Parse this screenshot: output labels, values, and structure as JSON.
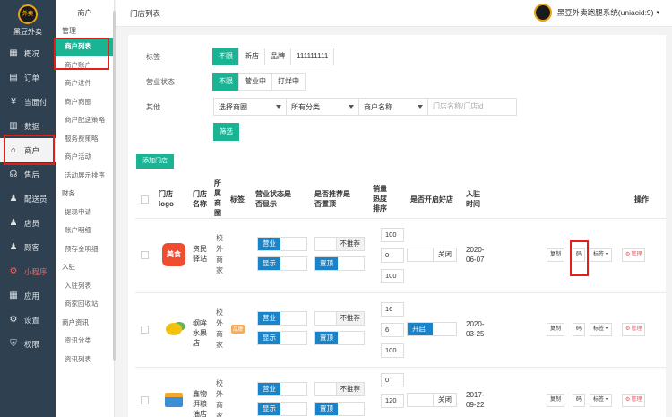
{
  "brand": {
    "name": "黑豆外卖",
    "logo_text": "外卖"
  },
  "main_nav": [
    {
      "label": "概况",
      "icon": "grid-icon"
    },
    {
      "label": "订单",
      "icon": "document-icon"
    },
    {
      "label": "当面付",
      "icon": "yen-circle-icon"
    },
    {
      "label": "数据",
      "icon": "chart-icon"
    },
    {
      "label": "商户",
      "icon": "store-icon"
    },
    {
      "label": "售后",
      "icon": "headset-icon"
    },
    {
      "label": "配送员",
      "icon": "person-icon"
    },
    {
      "label": "店员",
      "icon": "person-icon"
    },
    {
      "label": "顾客",
      "icon": "person-icon"
    },
    {
      "label": "小程序",
      "icon": "miniprogram-icon"
    },
    {
      "label": "应用",
      "icon": "apps-icon"
    },
    {
      "label": "设置",
      "icon": "gear-icon"
    },
    {
      "label": "权限",
      "icon": "shield-icon"
    }
  ],
  "sub_nav": {
    "title": "商户",
    "group1": "管理",
    "items1": [
      "商户列表",
      "商户账户",
      "商户进件",
      "商户商圈",
      "商户配送策略",
      "服务费策略",
      "商户活动",
      "活动展示排序"
    ],
    "group2": "财务",
    "items2": [
      "提现申请",
      "账户明细",
      "预存金明细"
    ],
    "group3": "入驻",
    "items3": [
      "入驻列表",
      "商家回收站"
    ],
    "group4": "商户资讯",
    "items4": [
      "资讯分类",
      "资讯列表"
    ]
  },
  "topbar": {
    "page_title": "门店列表",
    "system_name": "黑豆外卖跑腿系统(uniacid:9)"
  },
  "filters": {
    "tag_label": "标签",
    "tag_options": [
      "不限",
      "新店",
      "品牌",
      "111111111"
    ],
    "status_label": "营业状态",
    "status_options": [
      "不限",
      "营业中",
      "打烊中"
    ],
    "other_label": "其他",
    "circle_select": "选择商圈",
    "category_select": "所有分类",
    "name_select": "商户名称",
    "search_placeholder": "门店名称/门店id",
    "filter_button": "筛选"
  },
  "add_store_button": "添加门店",
  "table": {
    "headers": {
      "logo": "门店logo",
      "name": "门店名称",
      "owner": "所属商圈",
      "tag": "标签",
      "status": "营业状态是否显示",
      "recommend": "是否推荐是否置顶",
      "sales": "销量热度排序",
      "good_store": "是否开启好店",
      "join_time": "入驻时间",
      "actions": "操作"
    },
    "rows": [
      {
        "logo": "美食",
        "name": "资民驿站",
        "circle": "校外商家",
        "tag": "",
        "status_on": "营业",
        "show_on": "显示",
        "recommend": "不推荐",
        "top": "置顶",
        "sales": "100",
        "heat": "0",
        "sort": "100",
        "good_store": "关闭",
        "good_on": false,
        "date": "2020-06-07",
        "copy": "复制",
        "qr": "码",
        "tag_btn": "标签",
        "manage": "管理"
      },
      {
        "logo": "",
        "name": "纲哞水果店",
        "circle": "校外商家",
        "tag": "品牌",
        "status_on": "营业",
        "show_on": "显示",
        "recommend": "不推荐",
        "top": "置顶",
        "sales": "16",
        "heat": "6",
        "sort": "100",
        "good_store": "开启",
        "good_on": true,
        "date": "2020-03-25",
        "copy": "复制",
        "qr": "码",
        "tag_btn": "标签",
        "manage": "管理"
      },
      {
        "logo": "",
        "name": "鑫物湃粮油店",
        "circle": "校外商家",
        "tag": "",
        "status_on": "营业",
        "show_on": "显示",
        "recommend": "不推荐",
        "top": "置顶",
        "sales": "0",
        "heat": "120",
        "sort": "",
        "good_store": "关闭",
        "good_on": false,
        "date": "2017-09-22",
        "copy": "复制",
        "qr": "码",
        "tag_btn": "标签",
        "manage": "管理"
      }
    ]
  },
  "colors": {
    "sidebar": "#2f4050",
    "accent": "#1ab394",
    "toggle_blue": "#1c84c6",
    "highlight_red": "#e0201b"
  }
}
